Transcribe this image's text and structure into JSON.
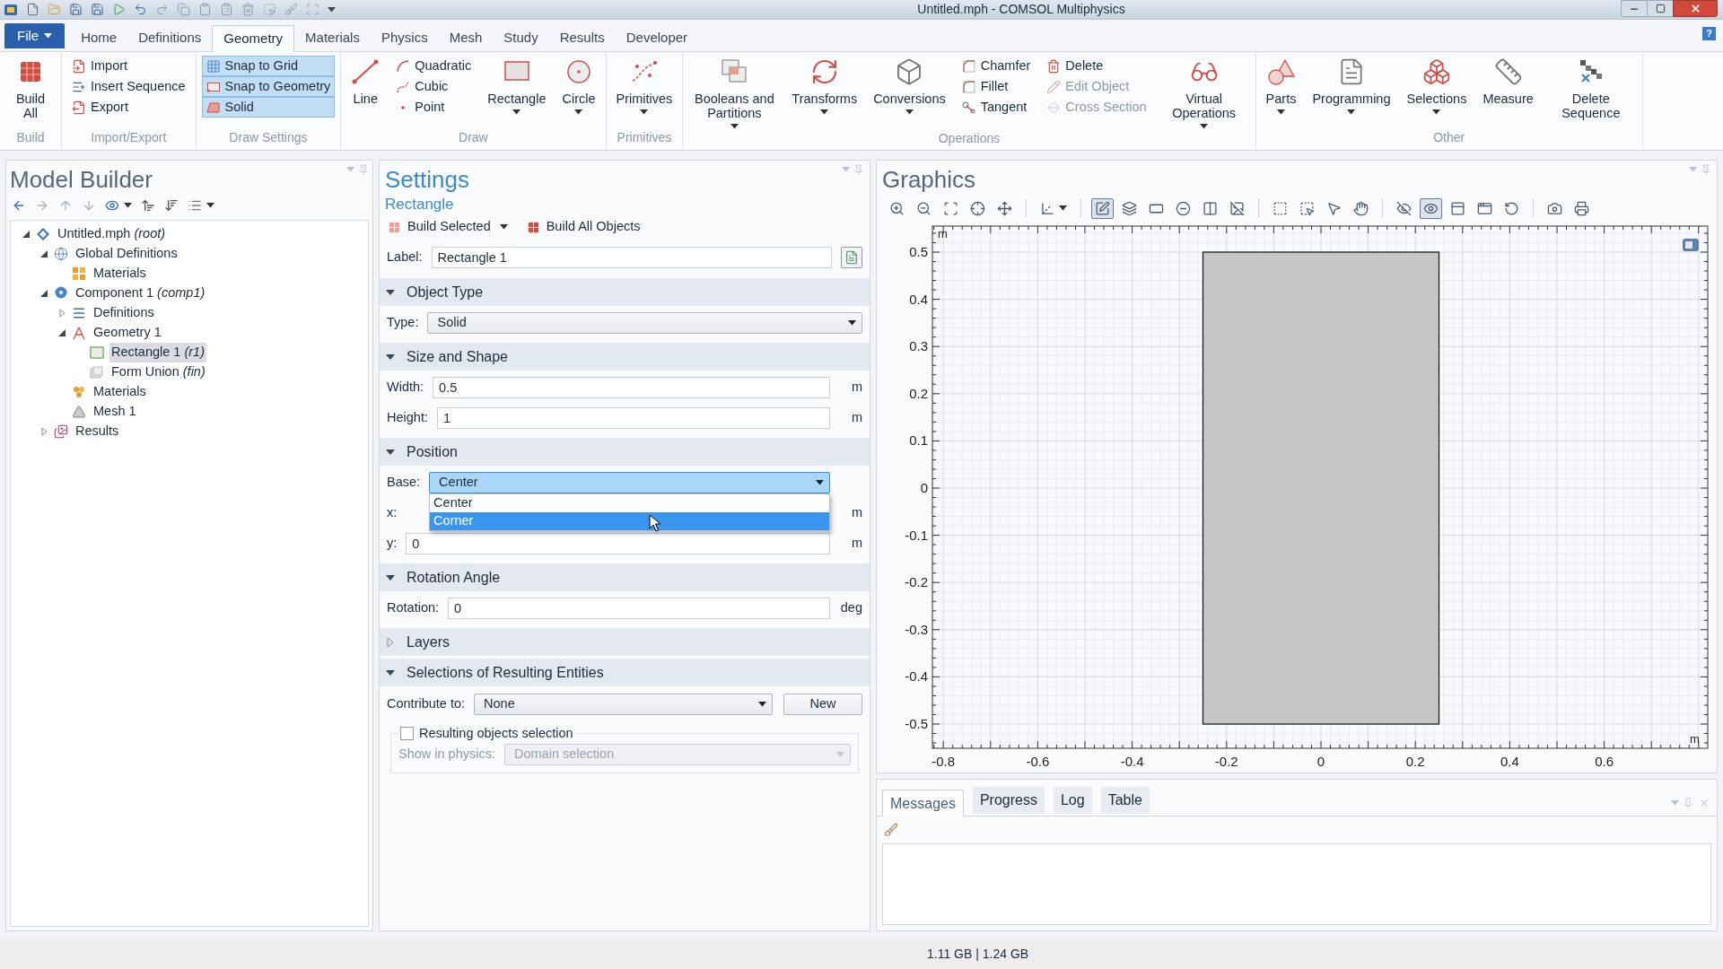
{
  "window": {
    "title": "Untitled.mph - COMSOL Multiphysics"
  },
  "menu": {
    "file": "File",
    "help": "?",
    "tabs": [
      {
        "label": "Home",
        "selected": false
      },
      {
        "label": "Definitions",
        "selected": false
      },
      {
        "label": "Geometry",
        "selected": true
      },
      {
        "label": "Materials",
        "selected": false
      },
      {
        "label": "Physics",
        "selected": false
      },
      {
        "label": "Mesh",
        "selected": false
      },
      {
        "label": "Study",
        "selected": false
      },
      {
        "label": "Results",
        "selected": false
      },
      {
        "label": "Developer",
        "selected": false
      }
    ]
  },
  "ribbon": {
    "groups": [
      {
        "label": "Build",
        "items": [
          {
            "kind": "large",
            "label": "Build All",
            "menu": false
          }
        ]
      },
      {
        "label": "Import/Export",
        "items": [
          {
            "kind": "column",
            "items": [
              {
                "label": "Import",
                "on": false,
                "disabled": false
              },
              {
                "label": "Insert Sequence",
                "on": false,
                "disabled": false
              },
              {
                "label": "Export",
                "on": false,
                "disabled": false
              }
            ]
          }
        ]
      },
      {
        "label": "Draw Settings",
        "items": [
          {
            "kind": "column",
            "items": [
              {
                "label": "Snap to Grid",
                "on": true,
                "disabled": false
              },
              {
                "label": "Snap to Geometry",
                "on": true,
                "disabled": false
              },
              {
                "label": "Solid",
                "on": true,
                "disabled": false
              }
            ]
          }
        ]
      },
      {
        "label": "Draw",
        "items": [
          {
            "kind": "large",
            "label": "Line",
            "menu": false
          },
          {
            "kind": "column",
            "items": [
              {
                "label": "Quadratic",
                "on": false,
                "disabled": false
              },
              {
                "label": "Cubic",
                "on": false,
                "disabled": false
              },
              {
                "label": "Point",
                "on": false,
                "disabled": false
              }
            ]
          },
          {
            "kind": "large",
            "label": "Rectangle",
            "menu": true
          },
          {
            "kind": "large",
            "label": "Circle",
            "menu": true
          }
        ]
      },
      {
        "label": "Primitives",
        "items": [
          {
            "kind": "large",
            "label": "Primitives",
            "menu": true
          }
        ]
      },
      {
        "label": "Operations",
        "items": [
          {
            "kind": "large",
            "label": "Booleans and Partitions",
            "menu": true
          },
          {
            "kind": "large",
            "label": "Transforms",
            "menu": true
          },
          {
            "kind": "large",
            "label": "Conversions",
            "menu": true
          },
          {
            "kind": "column",
            "items": [
              {
                "label": "Chamfer",
                "on": false,
                "disabled": false
              },
              {
                "label": "Fillet",
                "on": false,
                "disabled": false
              },
              {
                "label": "Tangent",
                "on": false,
                "disabled": false
              }
            ]
          },
          {
            "kind": "column",
            "items": [
              {
                "label": "Delete",
                "on": false,
                "disabled": false
              },
              {
                "label": "Edit Object",
                "on": false,
                "disabled": true
              },
              {
                "label": "Cross Section",
                "on": false,
                "disabled": true
              }
            ]
          },
          {
            "kind": "large",
            "label": "Virtual Operations",
            "menu": true
          }
        ]
      },
      {
        "label": "Other",
        "items": [
          {
            "kind": "large",
            "label": "Parts",
            "menu": true
          },
          {
            "kind": "large",
            "label": "Programming",
            "menu": true
          },
          {
            "kind": "large",
            "label": "Selections",
            "menu": true
          },
          {
            "kind": "large",
            "label": "Measure",
            "menu": false
          },
          {
            "kind": "large",
            "label": "Delete Sequence",
            "menu": false
          }
        ]
      }
    ]
  },
  "model_builder": {
    "title": "Model Builder",
    "tree": [
      {
        "label": "Untitled.mph *(root)*",
        "expanded": true,
        "selected": false,
        "children": [
          {
            "label": "Global Definitions",
            "expanded": true,
            "selected": false,
            "children": [
              {
                "label": "Materials",
                "selected": false
              }
            ]
          },
          {
            "label": "Component 1 *(comp1)*",
            "expanded": true,
            "selected": false,
            "children": [
              {
                "label": "Definitions",
                "expanded": false,
                "selected": false
              },
              {
                "label": "Geometry 1",
                "expanded": true,
                "selected": false,
                "children": [
                  {
                    "label": "Rectangle 1 *(r1)*",
                    "selected": true
                  },
                  {
                    "label": "Form Union *(fin)*",
                    "selected": false
                  }
                ]
              },
              {
                "label": "Materials",
                "selected": false
              },
              {
                "label": "Mesh 1",
                "selected": false
              }
            ]
          },
          {
            "label": "Results",
            "expanded": false,
            "selected": false
          }
        ]
      }
    ]
  },
  "settings": {
    "title": "Settings",
    "subtitle": "Rectangle",
    "actions": [
      {
        "label": "Build Selected",
        "menu": true
      },
      {
        "label": "Build All Objects",
        "menu": false
      }
    ],
    "label_field": {
      "label": "Label:",
      "value": "Rectangle 1"
    },
    "sections": [
      {
        "title": "Object Type",
        "expanded": true,
        "rows": [
          {
            "kind": "select",
            "label": "Type:",
            "value": "Solid",
            "open": false
          }
        ]
      },
      {
        "title": "Size and Shape",
        "expanded": true,
        "rows": [
          {
            "kind": "field",
            "label": "Width:",
            "value": "0.5",
            "unit": "m"
          },
          {
            "kind": "field",
            "label": "Height:",
            "value": "1",
            "unit": "m"
          }
        ]
      },
      {
        "title": "Position",
        "expanded": true,
        "rows": [
          {
            "kind": "select",
            "label": "Base:",
            "value": "Center",
            "open": true,
            "options": [
              {
                "label": "Center",
                "highlighted": false
              },
              {
                "label": "Corner",
                "highlighted": true
              }
            ]
          },
          {
            "kind": "covered",
            "label": "x:",
            "unit": "m"
          },
          {
            "kind": "field",
            "label": "y:",
            "value": "0",
            "unit": "m"
          }
        ]
      },
      {
        "title": "Rotation Angle",
        "expanded": true,
        "rows": [
          {
            "kind": "field",
            "label": "Rotation:",
            "value": "0",
            "unit": "deg"
          }
        ]
      },
      {
        "title": "Layers",
        "expanded": false
      },
      {
        "title": "Selections of Resulting Entities",
        "expanded": true,
        "rows": [
          {
            "kind": "select_button",
            "label": "Contribute to:",
            "value": "None",
            "button": "New"
          },
          {
            "kind": "group",
            "checkbox": {
              "label": "Resulting objects selection",
              "checked": false
            },
            "select": {
              "label": "Show in physics:",
              "value": "Domain selection",
              "disabled": true
            }
          }
        ]
      }
    ]
  },
  "graphics": {
    "title": "Graphics",
    "toolbar": [
      {
        "on": false
      },
      {
        "on": false
      },
      {
        "on": false
      },
      {
        "on": false
      },
      {
        "on": false
      },
      {
        "on": false
      },
      {
        "on": true
      },
      {
        "on": false
      },
      {
        "on": false
      },
      {
        "on": false
      },
      {
        "on": false
      },
      {
        "on": false
      },
      {
        "on": false
      },
      {
        "on": false
      },
      {
        "on": false
      },
      {
        "on": false
      },
      {
        "on": false
      },
      {
        "on": true
      },
      {
        "on": false
      },
      {
        "on": false
      },
      {
        "on": false
      },
      {
        "on": false
      },
      {
        "on": false
      }
    ],
    "axes": {
      "x_ticks": [
        "-0.8",
        "-0.6",
        "-0.4",
        "-0.2",
        "0",
        "0.2",
        "0.4",
        "0.6"
      ],
      "y_ticks": [
        "0.5",
        "0.4",
        "0.3",
        "0.2",
        "0.1",
        "0",
        "-0.1",
        "-0.2",
        "-0.3",
        "-0.4",
        "-0.5"
      ],
      "x_unit": "m",
      "y_unit": "m"
    }
  },
  "messages": {
    "tabs": [
      {
        "label": "Messages",
        "selected": true
      },
      {
        "label": "Progress",
        "selected": false
      },
      {
        "label": "Log",
        "selected": false
      },
      {
        "label": "Table",
        "selected": false
      }
    ]
  },
  "status_bar": {
    "memory": "1.11 GB | 1.24 GB"
  }
}
